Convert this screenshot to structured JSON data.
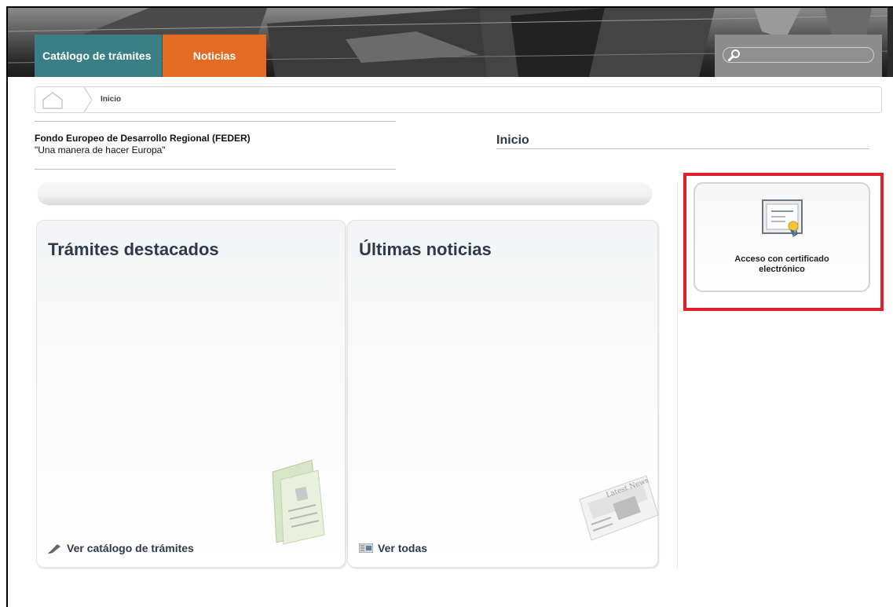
{
  "header": {
    "nav": [
      {
        "label": "Catálogo de trámites"
      },
      {
        "label": "Noticias"
      }
    ],
    "search": {
      "placeholder": ""
    }
  },
  "breadcrumb": {
    "current": "Inicio"
  },
  "site": {
    "title": "Fondo Europeo de Desarrollo Regional (FEDER)",
    "slogan": "\"Una manera de hacer Europa\""
  },
  "page": {
    "heading": "Inicio"
  },
  "panels": {
    "tramites": {
      "title": "Trámites destacados",
      "link_label": "Ver catálogo de trámites"
    },
    "noticias": {
      "title": "Últimas noticias",
      "link_label": "Ver todas",
      "illustration_text": "Latest News"
    }
  },
  "certificate": {
    "label": "Acceso con certificado electrónico"
  },
  "colors": {
    "teal_tab": "#3a7f86",
    "orange_tab": "#e36b24",
    "highlight": "#e0202a",
    "heading_text": "#2d3a4a"
  },
  "icons": [
    "home-icon",
    "search-icon",
    "pen-icon",
    "newspaper-icon",
    "certificate-icon",
    "folder-illustration",
    "newspaper-illustration"
  ]
}
